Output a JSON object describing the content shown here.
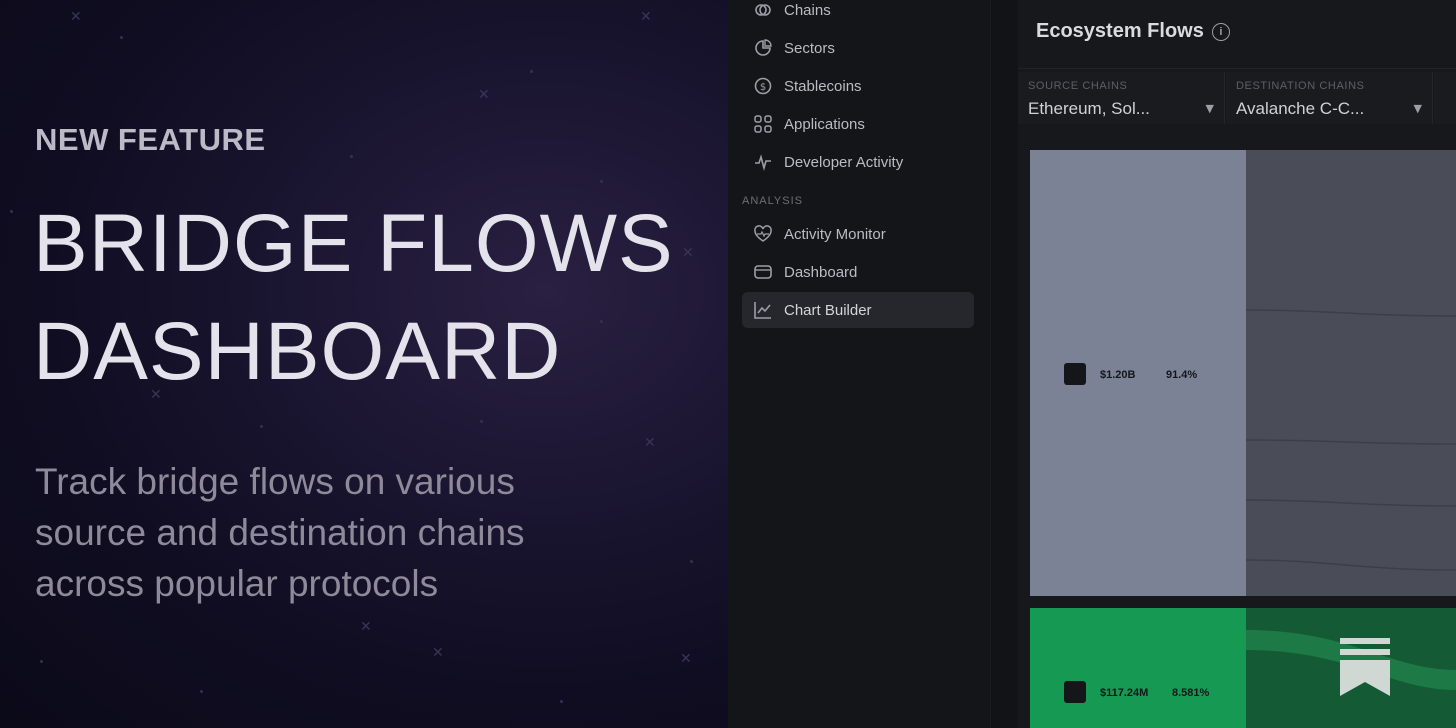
{
  "promo": {
    "eyebrow": "NEW FEATURE",
    "headline_line1": "BRIDGE FLOWS",
    "headline_line2": "DASHBOARD",
    "subtext_line1": "Track bridge flows on various",
    "subtext_line2": "source and destination chains",
    "subtext_line3": "across popular protocols"
  },
  "sidebar": {
    "items": [
      {
        "label": "Chains",
        "icon": "chains-icon"
      },
      {
        "label": "Sectors",
        "icon": "sectors-icon"
      },
      {
        "label": "Stablecoins",
        "icon": "stablecoins-icon"
      },
      {
        "label": "Applications",
        "icon": "applications-icon"
      },
      {
        "label": "Developer Activity",
        "icon": "developer-activity-icon"
      }
    ],
    "analysis_label": "ANALYSIS",
    "analysis_items": [
      {
        "label": "Activity Monitor",
        "icon": "activity-monitor-icon"
      },
      {
        "label": "Dashboard",
        "icon": "dashboard-icon"
      },
      {
        "label": "Chart Builder",
        "icon": "chart-builder-icon",
        "active": true
      }
    ]
  },
  "card": {
    "title": "Ecosystem Flows",
    "filters": [
      {
        "label": "SOURCE CHAINS",
        "value": "Ethereum, Sol..."
      },
      {
        "label": "DESTINATION CHAINS",
        "value": "Avalanche C-C..."
      }
    ]
  },
  "chart_data": {
    "type": "sankey",
    "nodes": [
      {
        "value_label": "$1.20B",
        "share_label": "91.4%",
        "color": "#7c8296",
        "share": 0.914
      },
      {
        "value_label": "$117.24M",
        "share_label": "8.581%",
        "color": "#169a53",
        "share": 0.086
      }
    ]
  },
  "colors": {
    "promo_bg": "#100d22",
    "app_bg": "#121316",
    "accent_green": "#169a53",
    "node_gray": "#7c8296"
  }
}
